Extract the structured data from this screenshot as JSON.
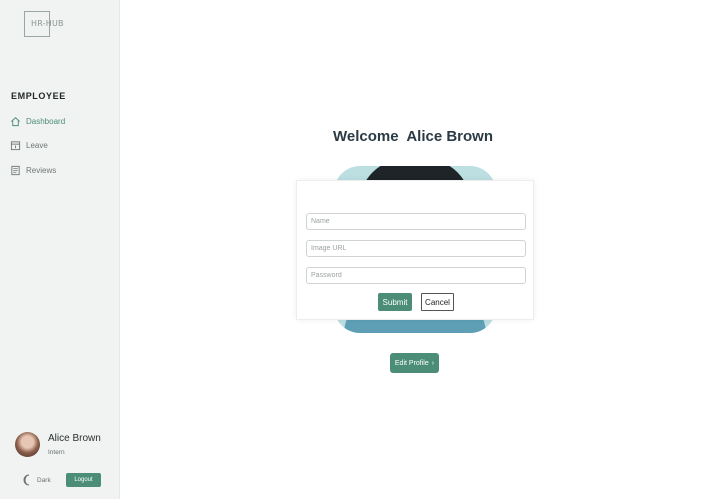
{
  "brand": {
    "logo_text": "HR-HUB"
  },
  "sidebar": {
    "role_heading": "EMPLOYEE",
    "items": [
      {
        "label": "Dashboard",
        "icon": "home-icon",
        "active": true
      },
      {
        "label": "Leave",
        "icon": "calendar-icon",
        "active": false
      },
      {
        "label": "Reviews",
        "icon": "document-icon",
        "active": false
      }
    ],
    "profile": {
      "name": "Alice Brown",
      "role": "Intern"
    },
    "theme_label": "Dark",
    "logout_label": "Logout"
  },
  "main": {
    "welcome": "Welcome  Alice Brown",
    "edit_label": "Edit Profile"
  },
  "modal": {
    "name_placeholder": "Name",
    "image_placeholder": "Image URL",
    "password_placeholder": "Password",
    "submit_label": "Submit",
    "cancel_label": "Cancel"
  },
  "colors": {
    "accent": "#4b8d76",
    "sidebar_bg": "#f1f3f2",
    "heading": "#2c3a45"
  }
}
